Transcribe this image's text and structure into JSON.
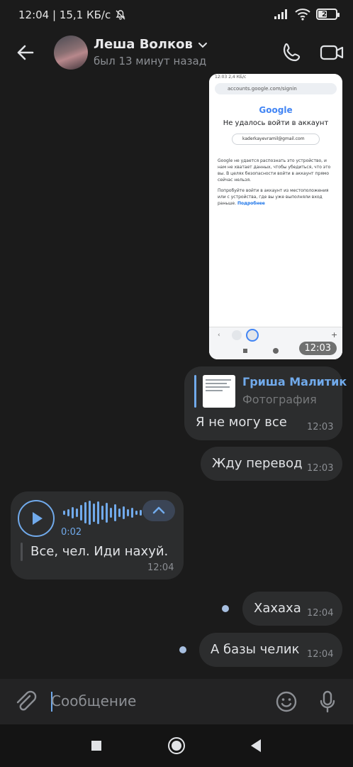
{
  "status_bar": {
    "time_speed": "12:04 | 15,1 КБ/с",
    "battery": "21"
  },
  "header": {
    "name": "Леша Волков",
    "last_seen": "был 13 минут назад"
  },
  "image_message": {
    "time": "12:03",
    "screenshot": {
      "status": "12:03 2,4 КБ/с",
      "url": "accounts.google.com/signin",
      "brand": "Google",
      "title": "Не удалось войти в аккаунт",
      "account": "kaderkayevramil@gmail.com",
      "para1": "Google не удается распознать это устройство, и нам не хватает данных, чтобы убедиться, что это вы. В целях безопасности войти в аккаунт прямо сейчас нельзя.",
      "para2": "Попробуйте войти в аккаунт из местоположения или с устройства, где вы уже выполняли вход раньше.",
      "more": "Подробнее"
    }
  },
  "reply_message": {
    "reply_author": "Гриша Малитик",
    "reply_type": "Фотография",
    "text": "Я не могу все",
    "time": "12:03"
  },
  "message_wait": {
    "text": "Жду перевод",
    "time": "12:03"
  },
  "voice_message": {
    "duration": "0:02",
    "transcript": "Все, чел. Иди нахуй.",
    "time": "12:04"
  },
  "message_haha": {
    "text": "Хахаха",
    "time": "12:04"
  },
  "message_bazy": {
    "text": "А базы челик",
    "time": "12:04"
  },
  "composer": {
    "placeholder": "Сообщение"
  },
  "colors": {
    "background": "#1b1b1b",
    "bubble": "#2c2d2e",
    "accent": "#71aaeb",
    "text": "#e1e3e6",
    "muted": "#8c8f94"
  },
  "icons": [
    "arrow-back-icon",
    "chevron-down-icon",
    "phone-icon",
    "video-camera-icon",
    "play-icon",
    "chevron-up-icon",
    "paperclip-icon",
    "smile-icon",
    "microphone-icon",
    "square-icon",
    "circle-icon",
    "triangle-back-icon"
  ]
}
